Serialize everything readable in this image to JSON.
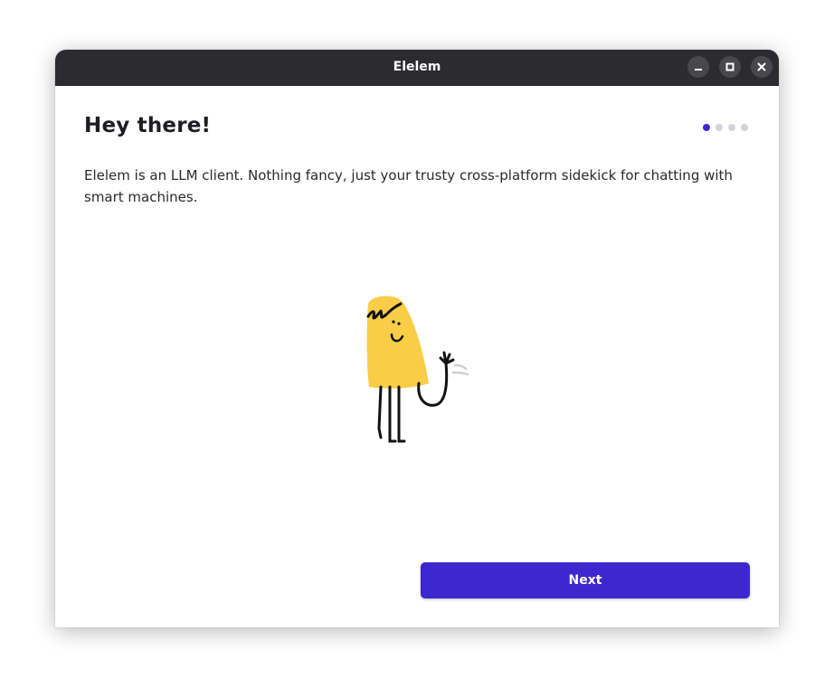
{
  "window": {
    "title": "Elelem"
  },
  "window_controls": {
    "minimize_icon": "minimize-icon",
    "maximize_icon": "maximize-icon",
    "close_icon": "close-icon"
  },
  "onboarding": {
    "heading": "Hey there!",
    "description": "Elelem is an LLM client. Nothing fancy, just your trusty cross-platform sidekick for chatting with smart machines.",
    "pages_total": 4,
    "current_page": 1,
    "illustration": "waving-yellow-character",
    "next_label": "Next"
  },
  "colors": {
    "accent": "#3f27d0",
    "titlebar": "#2c2c30",
    "character": "#f9cd48",
    "dot_inactive": "#d4d4da"
  }
}
